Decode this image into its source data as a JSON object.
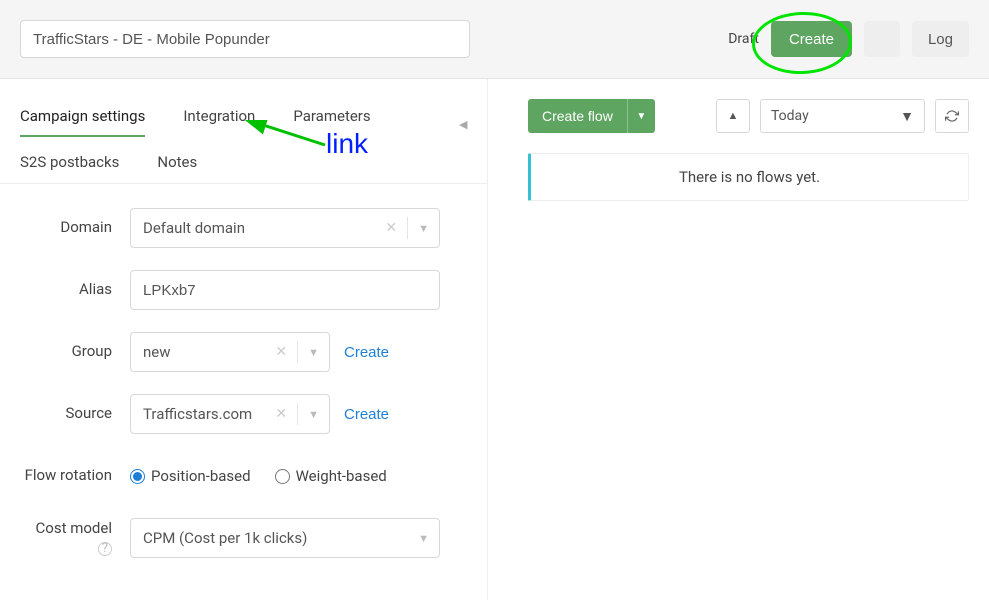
{
  "topbar": {
    "campaign_name": "TrafficStars - DE - Mobile Popunder",
    "status": "Draft",
    "create_btn": "Create",
    "log_btn": "Log"
  },
  "tabs": {
    "items": [
      {
        "label": "Campaign settings",
        "active": true
      },
      {
        "label": "Integration",
        "active": false
      },
      {
        "label": "Parameters",
        "active": false
      },
      {
        "label": "S2S postbacks",
        "active": false
      },
      {
        "label": "Notes",
        "active": false
      }
    ]
  },
  "annotation": {
    "text": "link"
  },
  "form": {
    "domain": {
      "label": "Domain",
      "value": "Default domain"
    },
    "alias": {
      "label": "Alias",
      "value": "LPKxb7"
    },
    "group": {
      "label": "Group",
      "value": "new",
      "create": "Create"
    },
    "source": {
      "label": "Source",
      "value": "Trafficstars.com",
      "create": "Create"
    },
    "flow_rotation": {
      "label": "Flow rotation",
      "options": [
        {
          "label": "Position-based",
          "checked": true
        },
        {
          "label": "Weight-based",
          "checked": false
        }
      ]
    },
    "cost_model": {
      "label": "Cost model",
      "value": "CPM (Cost per 1k clicks)"
    }
  },
  "rightcol": {
    "create_flow": "Create flow",
    "date_range": "Today",
    "empty_msg": "There is no flows yet."
  }
}
